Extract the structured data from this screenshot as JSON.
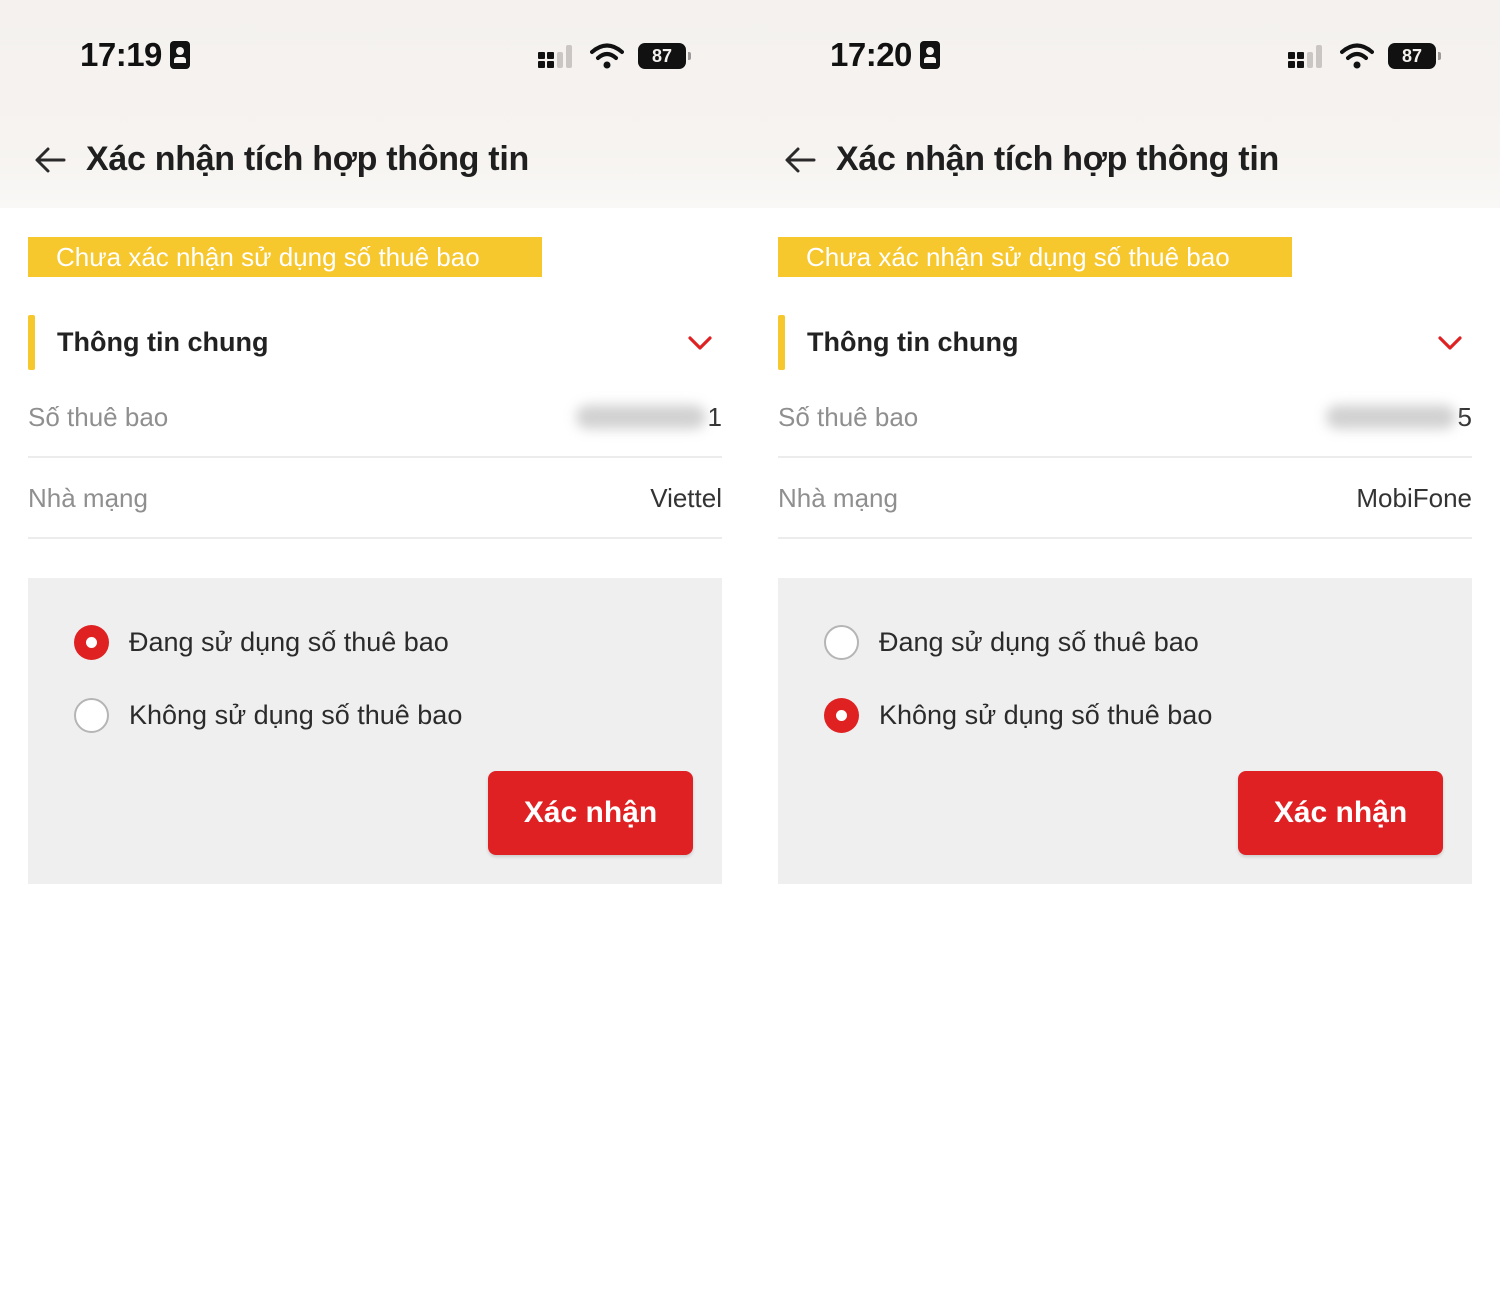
{
  "screens": [
    {
      "status_bar": {
        "time": "17:19",
        "battery": "87"
      },
      "header": {
        "title": "Xác nhận tích hợp thông tin"
      },
      "status_banner": "Chưa xác nhận sử dụng số thuê bao",
      "section": {
        "title": "Thông tin chung"
      },
      "fields": {
        "subscriber": {
          "label": "Số thuê bao",
          "visible_suffix": "1"
        },
        "carrier": {
          "label": "Nhà mạng",
          "value": "Viettel"
        }
      },
      "options": [
        {
          "label": "Đang sử dụng số thuê bao",
          "selected": true
        },
        {
          "label": "Không sử dụng số thuê bao",
          "selected": false
        }
      ],
      "confirm_label": "Xác nhận"
    },
    {
      "status_bar": {
        "time": "17:20",
        "battery": "87"
      },
      "header": {
        "title": "Xác nhận tích hợp thông tin"
      },
      "status_banner": "Chưa xác nhận sử dụng số thuê bao",
      "section": {
        "title": "Thông tin chung"
      },
      "fields": {
        "subscriber": {
          "label": "Số thuê bao",
          "visible_suffix": "5"
        },
        "carrier": {
          "label": "Nhà mạng",
          "value": "MobiFone"
        }
      },
      "options": [
        {
          "label": "Đang sử dụng số thuê bao",
          "selected": false
        },
        {
          "label": "Không sử dụng số thuê bao",
          "selected": true
        }
      ],
      "confirm_label": "Xác nhận"
    }
  ],
  "colors": {
    "accent_red": "#e02124",
    "banner_yellow": "#f7c72e",
    "panel_gray": "#efefef",
    "label_gray": "#8f8f8f"
  },
  "icons": [
    "back-arrow-icon",
    "chevron-down-icon",
    "signal-icon",
    "wifi-icon",
    "battery-icon",
    "id-card-icon"
  ]
}
